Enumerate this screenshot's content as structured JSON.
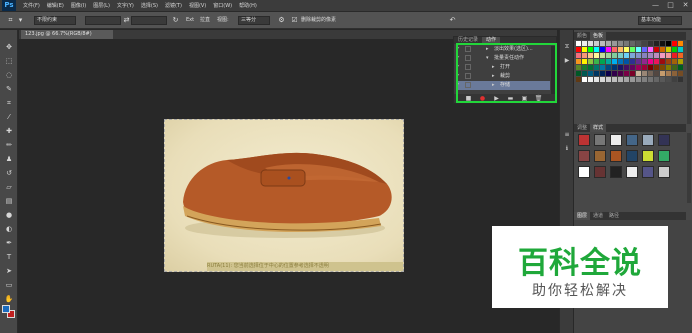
{
  "app": {
    "logo": "Ps"
  },
  "menu": [
    "文件(F)",
    "编辑(E)",
    "图像(I)",
    "图层(L)",
    "文字(Y)",
    "选择(S)",
    "滤镜(T)",
    "视图(V)",
    "窗口(W)",
    "帮助(H)"
  ],
  "window_controls": [
    "—",
    "□",
    "✕"
  ],
  "options": {
    "mode_select": "不限约束",
    "label_fixed": "Ext",
    "label_px": "拉直",
    "view_label": "视图:",
    "view_value": "三等分",
    "delete_checkbox_label": "删除裁剪的像素",
    "workspace": "基本功能"
  },
  "document_tab": {
    "title": "123.jpg @ 66.7%(RGB/8#)"
  },
  "actions_panel": {
    "tabs": [
      "历史记录",
      "动作"
    ],
    "rows": [
      {
        "label": "淡出效果(选区)...",
        "indent": 1
      },
      {
        "label": "批量责任动作",
        "indent": 0
      },
      {
        "label": "打开",
        "indent": 2
      },
      {
        "label": "裁剪",
        "indent": 2
      },
      {
        "label": "存储",
        "indent": 2
      }
    ],
    "footer_icons": [
      "■",
      "●",
      "▶",
      "▬",
      "▣",
      "🗑"
    ]
  },
  "photo": {
    "caption": "RUTA(11): 您当前选择位于中心的位置参考选择不透明"
  },
  "dock": {
    "top_tabs": [
      "颜色",
      "色板"
    ],
    "mid_tabs": [
      "调整",
      "样式"
    ],
    "bottom_tabs": [
      "图层",
      "通道",
      "路径"
    ]
  },
  "swatch_colors": [
    "#ffffff",
    "#eeeeee",
    "#dddddd",
    "#cccccc",
    "#bbbbbb",
    "#aaaaaa",
    "#999999",
    "#888888",
    "#777777",
    "#666666",
    "#555555",
    "#444444",
    "#333333",
    "#222222",
    "#111111",
    "#000000",
    "#ff0000",
    "#ff8800",
    "#ff0000",
    "#ffff00",
    "#00ff00",
    "#00ffff",
    "#0000ff",
    "#ff00ff",
    "#ff6666",
    "#ffbb66",
    "#ffff66",
    "#66ff66",
    "#66ffff",
    "#6666ff",
    "#ff66ff",
    "#cc0000",
    "#cc6600",
    "#cccc00",
    "#00cc00",
    "#00cccc",
    "#f26d7d",
    "#f7977a",
    "#fdc68a",
    "#fff79a",
    "#c4df9b",
    "#a3d39c",
    "#82ca9d",
    "#7accc8",
    "#6dcff6",
    "#7ea7d8",
    "#8493ca",
    "#8882be",
    "#a187be",
    "#bc8dbf",
    "#f49ac2",
    "#f6989d",
    "#ed1c24",
    "#f26522",
    "#f7941d",
    "#fff200",
    "#8dc63f",
    "#39b54a",
    "#00a651",
    "#00a99d",
    "#00aeef",
    "#0072bc",
    "#0054a6",
    "#2e3192",
    "#662d91",
    "#92278f",
    "#ec008c",
    "#ed145b",
    "#9e0b0f",
    "#a0410d",
    "#a36209",
    "#aba000",
    "#598527",
    "#197b30",
    "#007236",
    "#00746b",
    "#0076a3",
    "#004a80",
    "#003471",
    "#1b1464",
    "#440e62",
    "#630460",
    "#9e005d",
    "#9e0039",
    "#790000",
    "#7b2e00",
    "#7d4900",
    "#827b00",
    "#406618",
    "#005e20",
    "#005826",
    "#005952",
    "#005b7f",
    "#003663",
    "#002157",
    "#0d004c",
    "#32004b",
    "#4b0049",
    "#7b0046",
    "#7a0026",
    "#c7b299",
    "#998675",
    "#736357",
    "#534741",
    "#c69c6d",
    "#a67c52",
    "#8c6239",
    "#754c24",
    "#603913",
    "#ffffff",
    "#f2f2f2",
    "#e6e6e6",
    "#d9d9d9",
    "#cccccc",
    "#bfbfbf",
    "#b3b3b3",
    "#a6a6a6",
    "#999999",
    "#8c8c8c",
    "#808080",
    "#737373",
    "#666666",
    "#595959",
    "#4d4d4d",
    "#404040",
    "#333333"
  ],
  "style_colors": [
    "#b33",
    "#777",
    "#eee",
    "#468",
    "#9ab",
    "#335",
    "#844",
    "#963",
    "#a52",
    "#246",
    "#cd3",
    "#3a6",
    "#fff",
    "#633",
    "#222",
    "#eee",
    "#558",
    "#ccc"
  ],
  "watermark": {
    "title": "百科全说",
    "subtitle": "助你轻松解决"
  }
}
